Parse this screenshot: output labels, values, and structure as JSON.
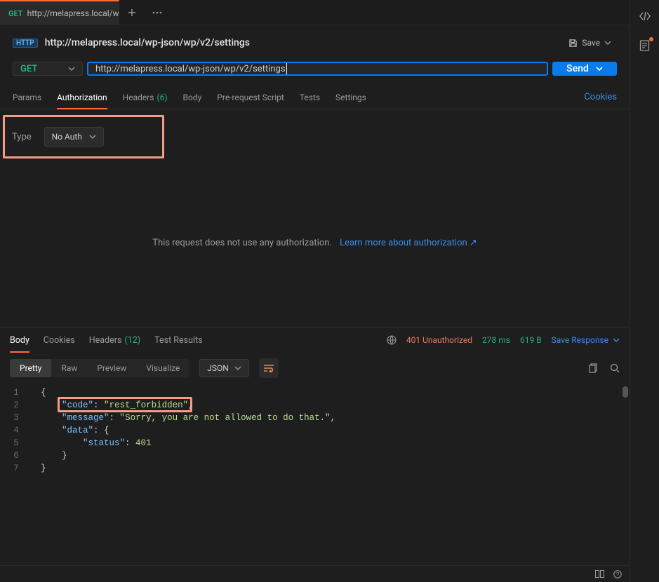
{
  "tab": {
    "method": "GET",
    "title": "http://melapress.local/wp"
  },
  "request": {
    "title": "http://melapress.local/wp-json/wp/v2/settings",
    "save_label": "Save",
    "method": "GET",
    "url": "http://melapress.local/wp-json/wp/v2/settings",
    "send_label": "Send"
  },
  "request_tabs": {
    "params": "Params",
    "authorization": "Authorization",
    "headers": "Headers",
    "headers_count": "(6)",
    "body": "Body",
    "prerequest": "Pre-request Script",
    "tests": "Tests",
    "settings": "Settings",
    "cookies": "Cookies"
  },
  "auth": {
    "type_label": "Type",
    "type_value": "No Auth",
    "message": "This request does not use any authorization.",
    "link_text": "Learn more about authorization ↗"
  },
  "response_tabs": {
    "body": "Body",
    "cookies": "Cookies",
    "headers": "Headers",
    "headers_count": "(12)",
    "test_results": "Test Results"
  },
  "response_status": {
    "status_text": "401 Unauthorized",
    "time": "278 ms",
    "size": "619 B",
    "save_response": "Save Response"
  },
  "view_modes": {
    "pretty": "Pretty",
    "raw": "Raw",
    "preview": "Preview",
    "visualize": "Visualize",
    "format": "JSON"
  },
  "response_body": {
    "lines": [
      "1",
      "2",
      "3",
      "4",
      "5",
      "6",
      "7"
    ],
    "json": {
      "code": "rest_forbidden",
      "message": "Sorry, you are not allowed to do that.",
      "data": {
        "status": 401
      }
    }
  }
}
